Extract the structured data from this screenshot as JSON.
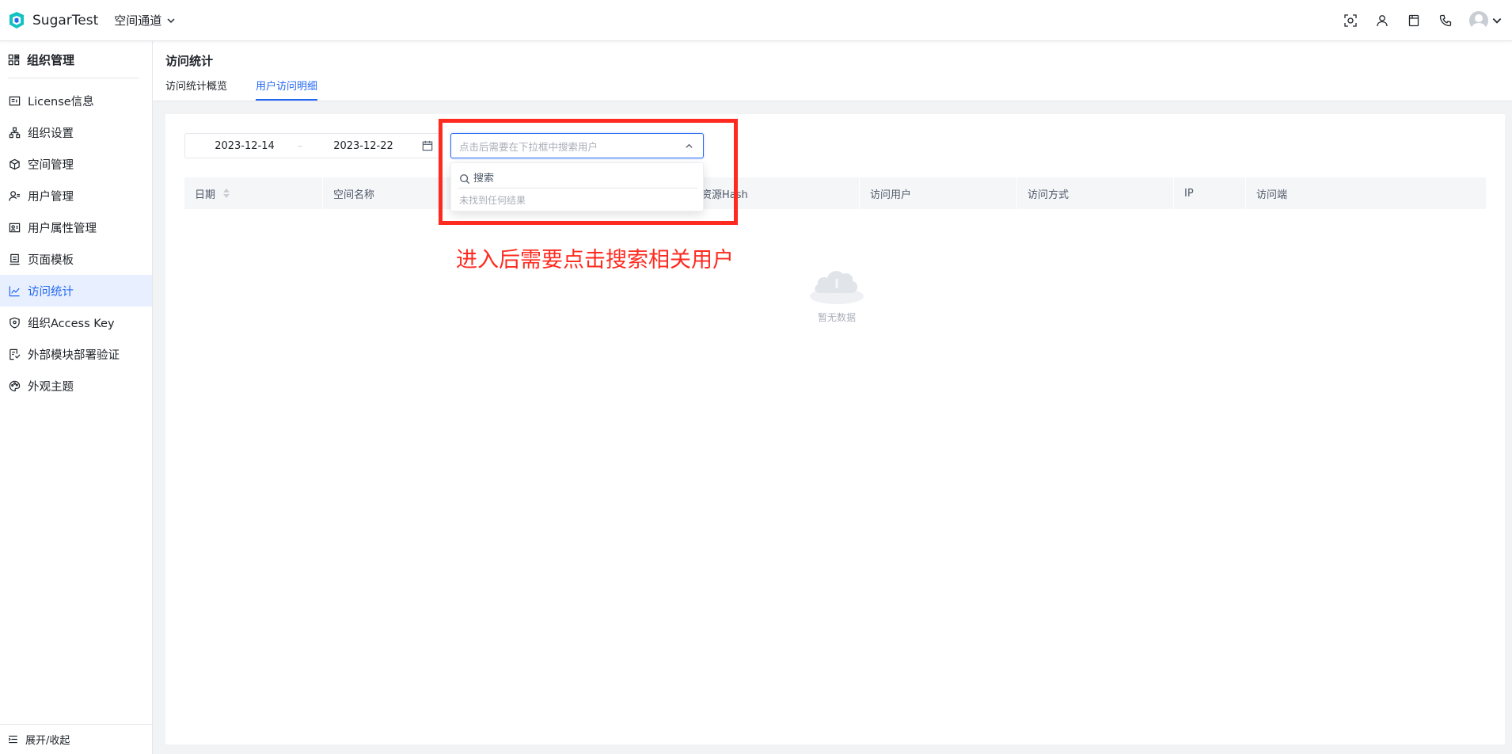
{
  "app": {
    "brand": "SugarTest",
    "space_name": "空间通道",
    "accent_color": "#2468f2",
    "logo_color": "#13c2c2"
  },
  "header": {
    "icons": [
      "scan-icon",
      "user-icon",
      "document-icon",
      "phone-icon"
    ],
    "avatar": "avatar-icon"
  },
  "sidebar": {
    "title": "组织管理",
    "items": [
      {
        "label": "License信息",
        "icon": "license-icon",
        "active": false
      },
      {
        "label": "组织设置",
        "icon": "org-tree-icon",
        "active": false
      },
      {
        "label": "空间管理",
        "icon": "cube-icon",
        "active": false
      },
      {
        "label": "用户管理",
        "icon": "user-manage-icon",
        "active": false
      },
      {
        "label": "用户属性管理",
        "icon": "user-attr-icon",
        "active": false
      },
      {
        "label": "页面模板",
        "icon": "template-icon",
        "active": false
      },
      {
        "label": "访问统计",
        "icon": "chart-line-icon",
        "active": true
      },
      {
        "label": "组织Access Key",
        "icon": "shield-icon",
        "active": false
      },
      {
        "label": "外部模块部署验证",
        "icon": "module-icon",
        "active": false
      },
      {
        "label": "外观主题",
        "icon": "palette-icon",
        "active": false
      }
    ],
    "footer": "展开/收起"
  },
  "page": {
    "title": "访问统计",
    "tabs": [
      {
        "label": "访问统计概览",
        "active": false
      },
      {
        "label": "用户访问明细",
        "active": true
      }
    ]
  },
  "filters": {
    "date_start": "2023-12-14",
    "date_sep": "–",
    "date_end": "2023-12-22",
    "user_select_placeholder": "点击后需要在下拉框中搜索用户",
    "dropdown": {
      "search_placeholder": "搜索",
      "empty_text": "未找到任何结果"
    }
  },
  "table": {
    "columns": [
      "日期",
      "空间名称",
      "",
      "",
      "资源Hash",
      "访问用户",
      "访问方式",
      "IP",
      "访问端"
    ],
    "empty_text": "暂无数据"
  },
  "annotation": {
    "text": "进入后需要点击搜索相关用户",
    "color": "#ff2a1f"
  }
}
